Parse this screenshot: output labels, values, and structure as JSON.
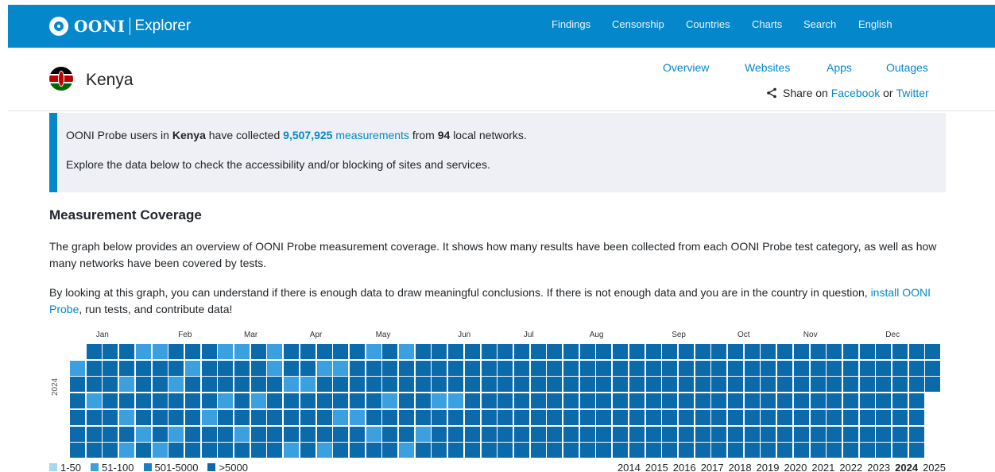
{
  "nav": {
    "logo_text": "OONI",
    "logo_sub": "Explorer",
    "links": [
      "Findings",
      "Censorship",
      "Countries",
      "Charts",
      "Search",
      "English"
    ]
  },
  "country": {
    "name": "Kenya",
    "tabs": [
      "Overview",
      "Websites",
      "Apps",
      "Outages"
    ],
    "share_prefix": "Share on",
    "share_facebook": "Facebook",
    "share_or": "or",
    "share_twitter": "Twitter"
  },
  "info": {
    "line1_a": "OONI Probe users in",
    "line1_country": "Kenya",
    "line1_b": "have collected",
    "line1_count": "9,507,925",
    "line1_measurements": "measurements",
    "line1_c": "from",
    "line1_networks": "94",
    "line1_d": "local networks.",
    "line2": "Explore the data below to check the accessibility and/or blocking of sites and services."
  },
  "coverage": {
    "title": "Measurement Coverage",
    "para1": "The graph below provides an overview of OONI Probe measurement coverage. It shows how many results have been collected from each OONI Probe test category, as well as how many networks have been covered by tests.",
    "para2_a": "By looking at this graph, you can understand if there is enough data to draw meaningful conclusions. If there is not enough data and you are in the country in question,",
    "para2_link": "install OONI Probe",
    "para2_b": ", run tests, and contribute data!"
  },
  "calendar": {
    "year": "2024",
    "months": [
      "Jan",
      "Feb",
      "Mar",
      "Apr",
      "May",
      "Jun",
      "Jul",
      "Aug",
      "Sep",
      "Oct",
      "Nov",
      "Dec"
    ],
    "colors": {
      "l1": "#a6d8f0",
      "l2": "#3aa0e0",
      "l3": "#1a7fc8",
      "l4": "#0a6aaa"
    },
    "lighter_cells": [
      [
        0,
        1
      ],
      [
        1,
        3
      ],
      [
        3,
        2
      ],
      [
        3,
        4
      ],
      [
        3,
        6
      ],
      [
        4,
        0
      ],
      [
        4,
        5
      ],
      [
        5,
        0
      ],
      [
        5,
        6
      ],
      [
        6,
        2
      ],
      [
        6,
        5
      ],
      [
        7,
        1
      ],
      [
        8,
        4
      ],
      [
        9,
        0
      ],
      [
        9,
        3
      ],
      [
        10,
        0
      ],
      [
        10,
        5
      ],
      [
        11,
        3
      ],
      [
        12,
        0
      ],
      [
        12,
        1
      ],
      [
        13,
        2
      ],
      [
        13,
        6
      ],
      [
        14,
        2
      ],
      [
        15,
        1
      ],
      [
        15,
        6
      ],
      [
        16,
        1
      ],
      [
        16,
        4
      ],
      [
        17,
        4
      ],
      [
        18,
        0
      ],
      [
        18,
        5
      ],
      [
        19,
        3
      ],
      [
        20,
        0
      ],
      [
        20,
        6
      ],
      [
        21,
        5
      ],
      [
        22,
        3
      ],
      [
        23,
        3
      ]
    ]
  },
  "legend": {
    "items": [
      {
        "label": "1-50",
        "color": "#a6d8f0"
      },
      {
        "label": "51-100",
        "color": "#3aa0e0"
      },
      {
        "label": "501-5000",
        "color": "#1a7fc8"
      },
      {
        "label": ">5000",
        "color": "#0a6aaa"
      }
    ]
  },
  "years": {
    "list": [
      "2014",
      "2015",
      "2016",
      "2017",
      "2018",
      "2019",
      "2020",
      "2021",
      "2022",
      "2023",
      "2024",
      "2025"
    ],
    "active": "2024"
  }
}
